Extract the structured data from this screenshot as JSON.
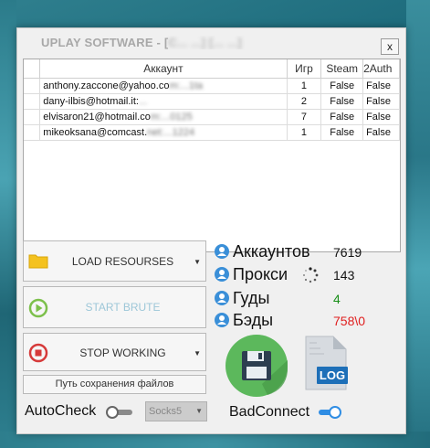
{
  "window": {
    "title": "UPLAY SOFTWARE - [",
    "title_obscured": "C...   ...] [...  ...]",
    "close_label": "x"
  },
  "table": {
    "columns": [
      "",
      "Аккаунт",
      "Игр",
      "Steam",
      "2Auth"
    ],
    "rows": [
      {
        "account": "anthony.zaccone@yahoo.co",
        "obscured": "m:...1ta",
        "games": "1",
        "steam": "False",
        "twoauth": "False"
      },
      {
        "account": "dany-ilbis@hotmail.it:",
        "obscured": "...",
        "games": "2",
        "steam": "False",
        "twoauth": "False"
      },
      {
        "account": "elvisaron21@hotmail.co",
        "obscured": "m:...0125",
        "games": "7",
        "steam": "False",
        "twoauth": "False"
      },
      {
        "account": "mikeoksana@comcast.",
        "obscured": "net:...1224",
        "games": "1",
        "steam": "False",
        "twoauth": "False"
      }
    ]
  },
  "buttons": {
    "load": "LOAD RESOURSES",
    "start": "START BRUTE",
    "stop": "STOP WORKING",
    "save_path": "Путь сохранения файлов"
  },
  "bottom": {
    "autocheck_label": "AutoCheck",
    "autocheck_on": false,
    "proxy_type": "Socks5",
    "badconnect_label": "BadConnect",
    "badconnect_on": true
  },
  "stats": {
    "accounts_label": "Аккаунтов",
    "accounts_value": "7619",
    "proxies_label": "Прокси",
    "proxies_value": "143",
    "goods_label": "Гуды",
    "goods_value": "4",
    "bads_label": "Бэды",
    "bads_value": "758\\0"
  },
  "icons": {
    "save": "floppy-disk-icon",
    "log": "log-file-icon",
    "log_text": "LOG"
  },
  "colors": {
    "goods": "#1a8f1a",
    "bads": "#e02020",
    "accent": "#3a8fd8",
    "save_circle": "#5cb85c"
  }
}
